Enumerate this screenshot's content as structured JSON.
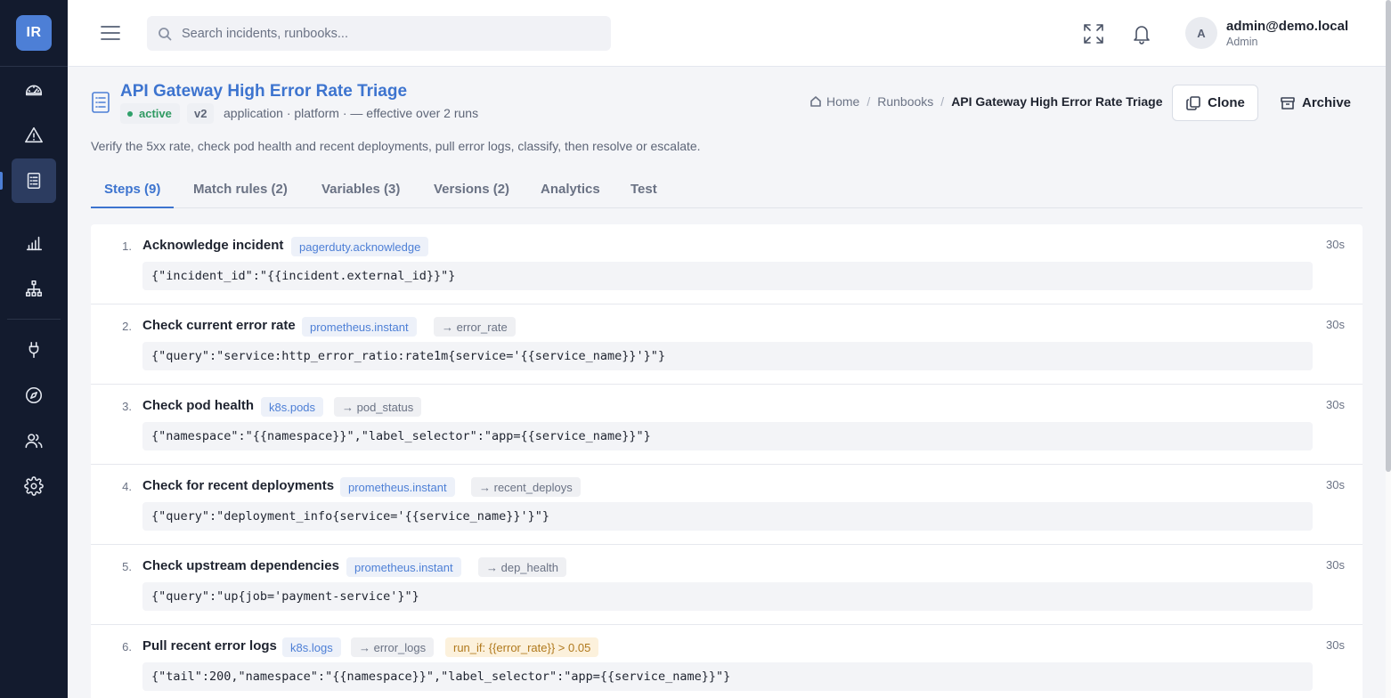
{
  "app": {
    "logo_text": "IR"
  },
  "sidebar": {
    "items": [
      {
        "name": "dashboard-icon"
      },
      {
        "name": "incidents-icon"
      },
      {
        "name": "runbooks-icon",
        "active": true
      },
      {
        "name": "analytics-icon"
      },
      {
        "name": "topology-icon"
      },
      {
        "name": "integrations-icon"
      },
      {
        "name": "explore-icon"
      },
      {
        "name": "team-icon"
      },
      {
        "name": "settings-icon"
      }
    ]
  },
  "header": {
    "search_placeholder": "Search incidents, runbooks...",
    "user": {
      "initial": "A",
      "name": "admin@demo.local",
      "role": "Admin"
    }
  },
  "page": {
    "title": "API Gateway High Error Rate Triage",
    "status": "active",
    "version": "v2",
    "meta": "application · platform · — effective over 2 runs",
    "description": "Verify the 5xx rate, check pod health and recent deployments, pull error logs, classify, then resolve or escalate.",
    "breadcrumb": {
      "home": "Home",
      "section": "Runbooks",
      "current": "API Gateway High Error Rate Triage"
    },
    "actions": {
      "clone": "Clone",
      "archive": "Archive"
    }
  },
  "tabs": [
    {
      "label": "Steps (9)",
      "active": true
    },
    {
      "label": "Match rules (2)"
    },
    {
      "label": "Variables (3)"
    },
    {
      "label": "Versions (2)"
    },
    {
      "label": "Analytics"
    },
    {
      "label": "Test"
    }
  ],
  "steps": [
    {
      "num": "1.",
      "title": "Acknowledge incident",
      "action": "pagerduty.acknowledge",
      "output": "",
      "condition": "",
      "code": "{\"incident_id\":\"{{incident.external_id}}\"}",
      "timeout": "30s"
    },
    {
      "num": "2.",
      "title": "Check current error rate",
      "action": "prometheus.instant",
      "output": "→ error_rate",
      "condition": "",
      "code": "{\"query\":\"service:http_error_ratio:rate1m{service='{{service_name}}'}\"}",
      "timeout": "30s"
    },
    {
      "num": "3.",
      "title": "Check pod health",
      "action": "k8s.pods",
      "output": "→ pod_status",
      "condition": "",
      "code": "{\"namespace\":\"{{namespace}}\",\"label_selector\":\"app={{service_name}}\"}",
      "timeout": "30s"
    },
    {
      "num": "4.",
      "title": "Check for recent deployments",
      "action": "prometheus.instant",
      "output": "→ recent_deploys",
      "condition": "",
      "code": "{\"query\":\"deployment_info{service='{{service_name}}'}\"}",
      "timeout": "30s"
    },
    {
      "num": "5.",
      "title": "Check upstream dependencies",
      "action": "prometheus.instant",
      "output": "→ dep_health",
      "condition": "",
      "code": "{\"query\":\"up{job='payment-service'}\"}",
      "timeout": "30s"
    },
    {
      "num": "6.",
      "title": "Pull recent error logs",
      "action": "k8s.logs",
      "output": "→ error_logs",
      "condition": "run_if: {{error_rate}} > 0.05",
      "code": "{\"tail\":200,\"namespace\":\"{{namespace}}\",\"label_selector\":\"app={{service_name}}\"}",
      "timeout": "30s"
    }
  ]
}
